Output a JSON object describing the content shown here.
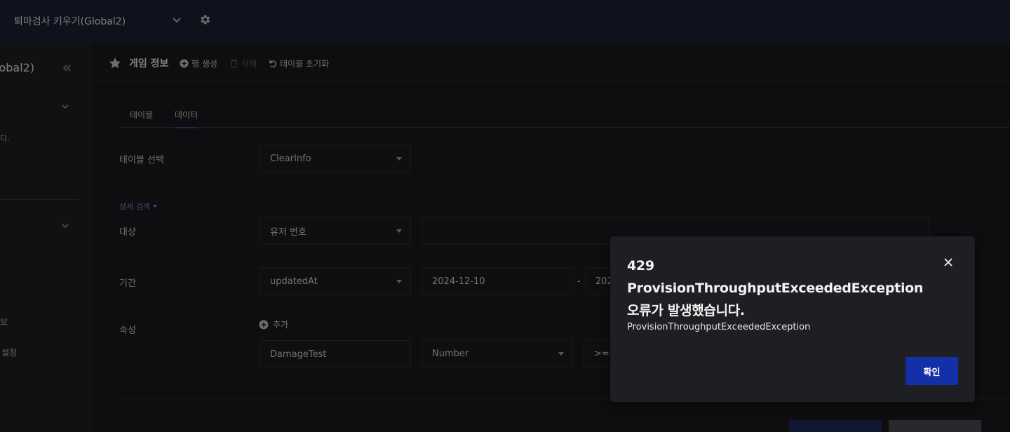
{
  "topbar": {
    "project_name": "퇴마검사 키우기(Global2)"
  },
  "sidebar": {
    "title": "lobal2)",
    "description": "다.",
    "items": [
      "보",
      "설정"
    ]
  },
  "toolbar": {
    "title": "게임 정보",
    "create_row": "행 생성",
    "delete": "삭제",
    "reset_table": "테이블 초기화"
  },
  "tabs": [
    "테이블",
    "데이터"
  ],
  "form": {
    "table_select_label": "테이블 선택",
    "table_select_value": "ClearInfo",
    "advanced_search": "상세 검색",
    "target_label": "대상",
    "target_value": "유저 번호",
    "target_input_value": "",
    "period_label": "기간",
    "period_field": "updatedAt",
    "period_start": "2024-12-10",
    "period_dash": "-",
    "period_end": "202",
    "attr_label": "속성",
    "add_label": "추가",
    "attr_name": "DamageTest",
    "attr_type": "Number",
    "attr_op": ">="
  },
  "modal": {
    "title": "429 ProvisionThroughputExceededException 오류가 발생했습니다.",
    "message": "ProvisionThroughputExceededException",
    "confirm": "확인"
  }
}
